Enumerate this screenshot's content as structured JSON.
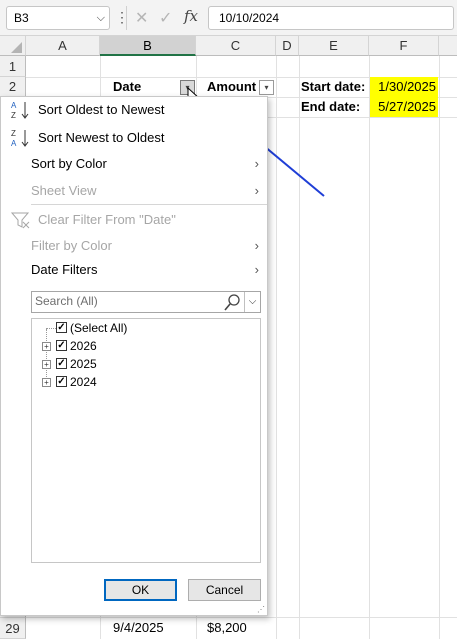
{
  "formula_bar": {
    "name_box": "B3",
    "formula": "10/10/2024",
    "fx_label": "fx"
  },
  "columns": [
    "A",
    "B",
    "C",
    "D",
    "E",
    "F"
  ],
  "rows": {
    "r1": "1",
    "r2": "2",
    "r29": "29"
  },
  "cells": {
    "B2": "Date",
    "C2": "Amount",
    "E2": "Start date:",
    "F2": "1/30/2025",
    "E3": "End date:",
    "F3": "5/27/2025",
    "B29": "9/4/2025",
    "C29": "$8,200"
  },
  "colors": {
    "highlight": "#ffff00",
    "arrow": "#1f3ed6",
    "ok_border": "#0067c0"
  },
  "filter_menu": {
    "sort_oldest": "Sort Oldest to Newest",
    "sort_newest": "Sort Newest to Oldest",
    "sort_by_color": "Sort by Color",
    "sheet_view": "Sheet View",
    "clear_filter": "Clear Filter From \"Date\"",
    "filter_by_color": "Filter by Color",
    "date_filters": "Date Filters",
    "search_placeholder": "Search (All)",
    "tree": [
      {
        "label": "(Select All)",
        "checked": true
      },
      {
        "label": "2026",
        "checked": true
      },
      {
        "label": "2025",
        "checked": true
      },
      {
        "label": "2024",
        "checked": true
      }
    ],
    "ok": "OK",
    "cancel": "Cancel"
  }
}
